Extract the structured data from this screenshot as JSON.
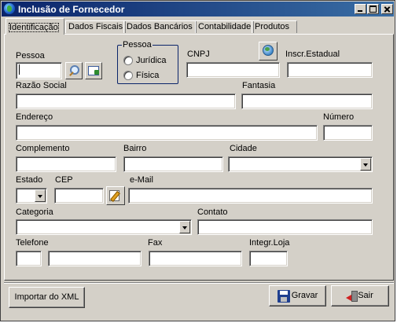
{
  "window": {
    "title": "Inclusão de Fornecedor"
  },
  "tabs": [
    "Identificação",
    "Dados Fiscais",
    "Dados Bancários",
    "Contabilidade",
    "Produtos"
  ],
  "form": {
    "pessoa_label": "Pessoa",
    "pessoa_group": {
      "title": "Pessoa",
      "options": [
        "Jurídica",
        "Física"
      ]
    },
    "cnpj_label": "CNPJ",
    "inscr_estadual_label": "Inscr.Estadual",
    "razao_social_label": "Razão Social",
    "fantasia_label": "Fantasia",
    "endereco_label": "Endereço",
    "numero_label": "Número",
    "complemento_label": "Complemento",
    "bairro_label": "Bairro",
    "cidade_label": "Cidade",
    "estado_label": "Estado",
    "cep_label": "CEP",
    "email_label": "e-Mail",
    "categoria_label": "Categoria",
    "contato_label": "Contato",
    "telefone_label": "Telefone",
    "fax_label": "Fax",
    "integr_loja_label": "Integr.Loja"
  },
  "buttons": {
    "importar": "Importar do XML",
    "gravar": "Gravar",
    "sair": "Sair"
  },
  "icons": {
    "app": "globe-app-icon",
    "search": "magnifier-icon",
    "card": "contact-card-icon",
    "cnpj_lookup": "globe-icon",
    "cep_lookup": "edit-icon",
    "gravar": "floppy-disk-icon",
    "sair": "exit-door-icon"
  }
}
